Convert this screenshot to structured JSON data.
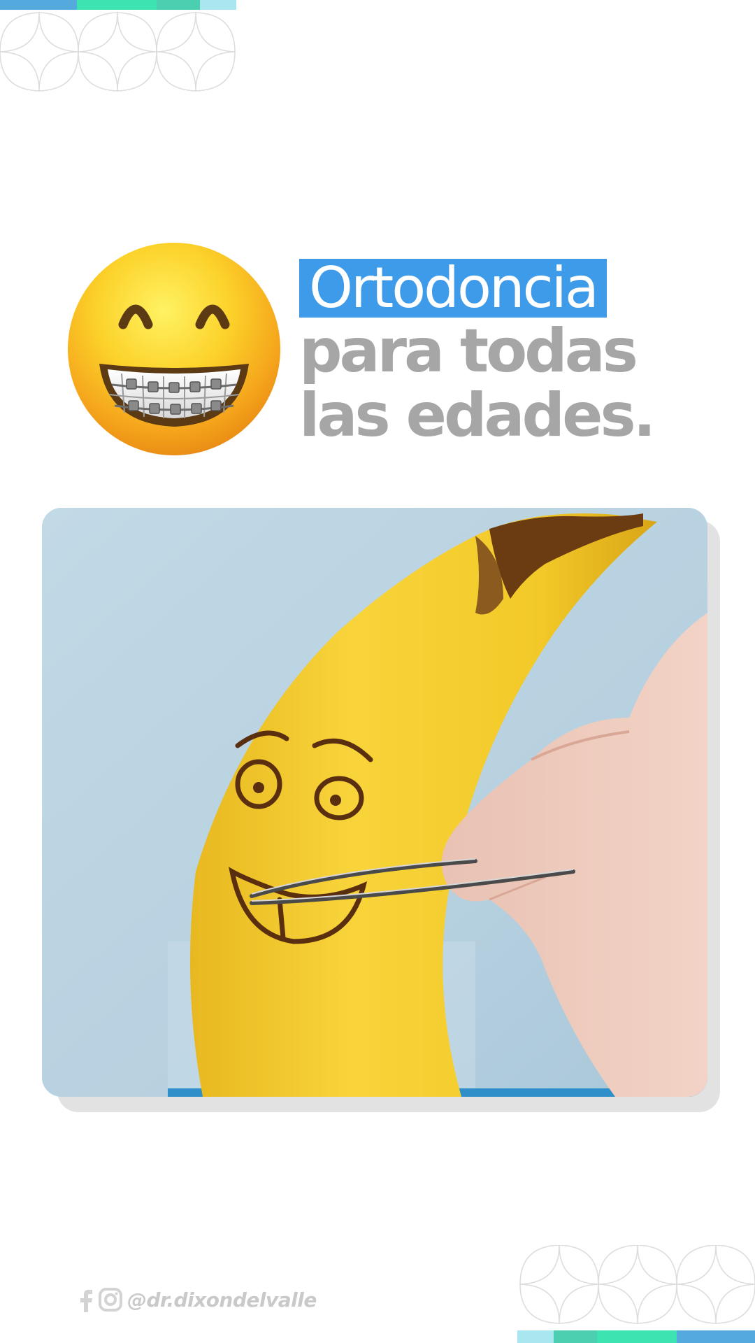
{
  "headline": {
    "highlight": "Ortodoncia",
    "line2": "para todas",
    "line3": "las edades."
  },
  "footer": {
    "handle": "@dr.dixondelvalle"
  },
  "icons": {
    "emoji": "grinning-face-with-braces-icon",
    "social": [
      "facebook-icon",
      "instagram-icon"
    ]
  },
  "colors": {
    "highlight_bg": "#3d9be9",
    "highlight_text": "#ffffff",
    "headline_gray": "#a6a6a6",
    "accent_bar": [
      "#55aadd",
      "#3de3b0",
      "#4ccfb0",
      "#a8e6f0"
    ],
    "footer_gray": "#c9c9c9"
  },
  "photo": {
    "subject": "banana-with-drawn-face-and-tweezers"
  }
}
